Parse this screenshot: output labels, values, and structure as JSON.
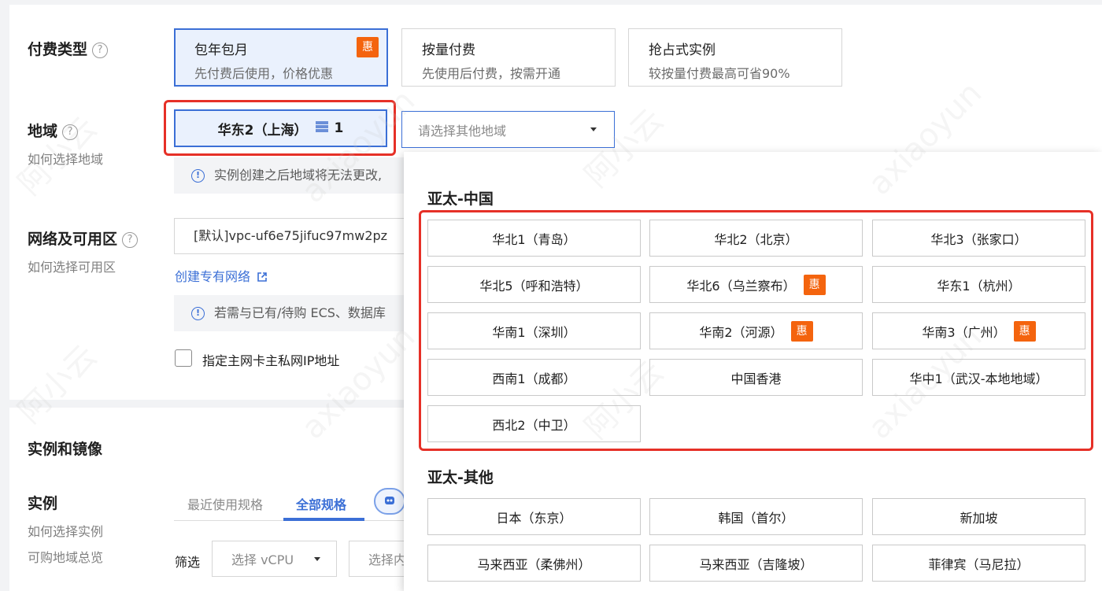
{
  "billing": {
    "label": "付费类型",
    "help": "?",
    "options": [
      {
        "title": "包年包月",
        "desc": "先付费后使用，价格优惠",
        "badge": "惠"
      },
      {
        "title": "按量付费",
        "desc": "先使用后付费，按需开通"
      },
      {
        "title": "抢占式实例",
        "desc": "较按量付费最高可省90%"
      }
    ]
  },
  "region": {
    "label": "地域",
    "help": "?",
    "sublabel": "如何选择地域",
    "selected": "华东2（上海）",
    "selected_count": "1",
    "other_placeholder": "请选择其他地域",
    "notice": "实例创建之后地域将无法更改,"
  },
  "network": {
    "label": "网络及可用区",
    "help": "?",
    "sublabel": "如何选择可用区",
    "vpc_value": "[默认]vpc-uf6e75jifuc97mw2pz",
    "create_link": "创建专有网络",
    "notice": "若需与已有/待购 ECS、数据库",
    "checkbox_label": "指定主网卡主私网IP地址"
  },
  "instance_section": {
    "title": "实例和镜像",
    "label": "实例",
    "sublabel1": "如何选择实例",
    "sublabel2": "可购地域总览",
    "tabs": [
      "最近使用规格",
      "全部规格"
    ],
    "filter_label": "筛选",
    "vcpu_placeholder": "选择 vCPU",
    "other_placeholder": "选择内"
  },
  "dropdown": {
    "groups": [
      {
        "title": "亚太-中国",
        "regions": [
          {
            "name": "华北1（青岛）"
          },
          {
            "name": "华北2（北京）"
          },
          {
            "name": "华北3（张家口）"
          },
          {
            "name": "华北5（呼和浩特）"
          },
          {
            "name": "华北6（乌兰察布）",
            "badge": "惠"
          },
          {
            "name": "华东1（杭州）"
          },
          {
            "name": "华南1（深圳）"
          },
          {
            "name": "华南2（河源）",
            "badge": "惠"
          },
          {
            "name": "华南3（广州）",
            "badge": "惠"
          },
          {
            "name": "西南1（成都）"
          },
          {
            "name": "中国香港"
          },
          {
            "name": "华中1（武汉-本地地域）"
          },
          {
            "name": "西北2（中卫）"
          }
        ]
      },
      {
        "title": "亚太-其他",
        "regions": [
          {
            "name": "日本（东京）"
          },
          {
            "name": "韩国（首尔）"
          },
          {
            "name": "新加坡"
          },
          {
            "name": "马来西亚（柔佛州）"
          },
          {
            "name": "马来西亚（吉隆坡）"
          },
          {
            "name": "菲律宾（马尼拉）"
          }
        ]
      }
    ]
  },
  "colors": {
    "accent": "#3b6fd6",
    "highlight": "#e63027",
    "badge": "#f4640e"
  }
}
